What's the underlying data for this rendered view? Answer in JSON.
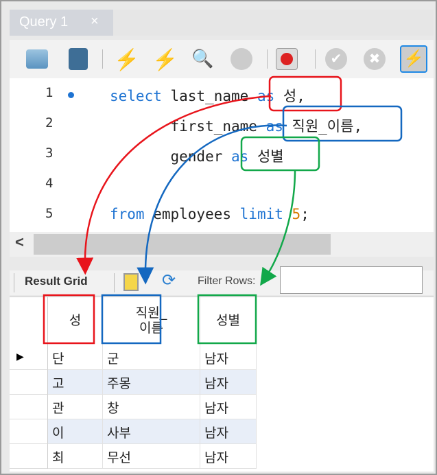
{
  "tab": {
    "title": "Query 1",
    "close": "×"
  },
  "toolbar": {
    "icons": [
      "open-folder-icon",
      "save-icon",
      "execute-icon",
      "execute-current-icon",
      "explain-icon",
      "stop-icon",
      "toggle-stop-on-error-icon",
      "commit-icon",
      "rollback-icon",
      "autocommit-icon"
    ]
  },
  "editor": {
    "lines": [
      {
        "n": "1",
        "parts": [
          {
            "t": "select",
            "c": "kw"
          },
          {
            "t": " last_name ",
            "c": ""
          },
          {
            "t": "as",
            "c": "kw"
          },
          {
            "t": " 성,",
            "c": ""
          }
        ]
      },
      {
        "n": "2",
        "parts": [
          {
            "t": "       first_name ",
            "c": ""
          },
          {
            "t": "as",
            "c": "kw"
          },
          {
            "t": " 직원_이름,",
            "c": ""
          }
        ]
      },
      {
        "n": "3",
        "parts": [
          {
            "t": "       gender ",
            "c": ""
          },
          {
            "t": "as",
            "c": "kw"
          },
          {
            "t": " 성별",
            "c": ""
          }
        ]
      },
      {
        "n": "4",
        "parts": []
      },
      {
        "n": "5",
        "parts": [
          {
            "t": "from",
            "c": "kw"
          },
          {
            "t": " employees ",
            "c": ""
          },
          {
            "t": "limit",
            "c": "kw"
          },
          {
            "t": " ",
            "c": ""
          },
          {
            "t": "5",
            "c": "num"
          },
          {
            "t": ";",
            "c": ""
          }
        ]
      }
    ]
  },
  "scroll": {
    "left_arrow": "<"
  },
  "results": {
    "result_grid": "Result Grid",
    "filter_label": "Filter Rows:",
    "filter_value": ""
  },
  "grid": {
    "headers": [
      "성",
      "직원_\n이름",
      "성별"
    ],
    "rows": [
      [
        "단",
        "군",
        "남자"
      ],
      [
        "고",
        "주몽",
        "남자"
      ],
      [
        "관",
        "창",
        "남자"
      ],
      [
        "이",
        "사부",
        "남자"
      ],
      [
        "최",
        "무선",
        "남자"
      ]
    ],
    "current_row_marker": "▶"
  },
  "colors": {
    "red": "#e8141b",
    "blue": "#1468c0",
    "green": "#12a84a",
    "keyword": "#1e73d2"
  }
}
